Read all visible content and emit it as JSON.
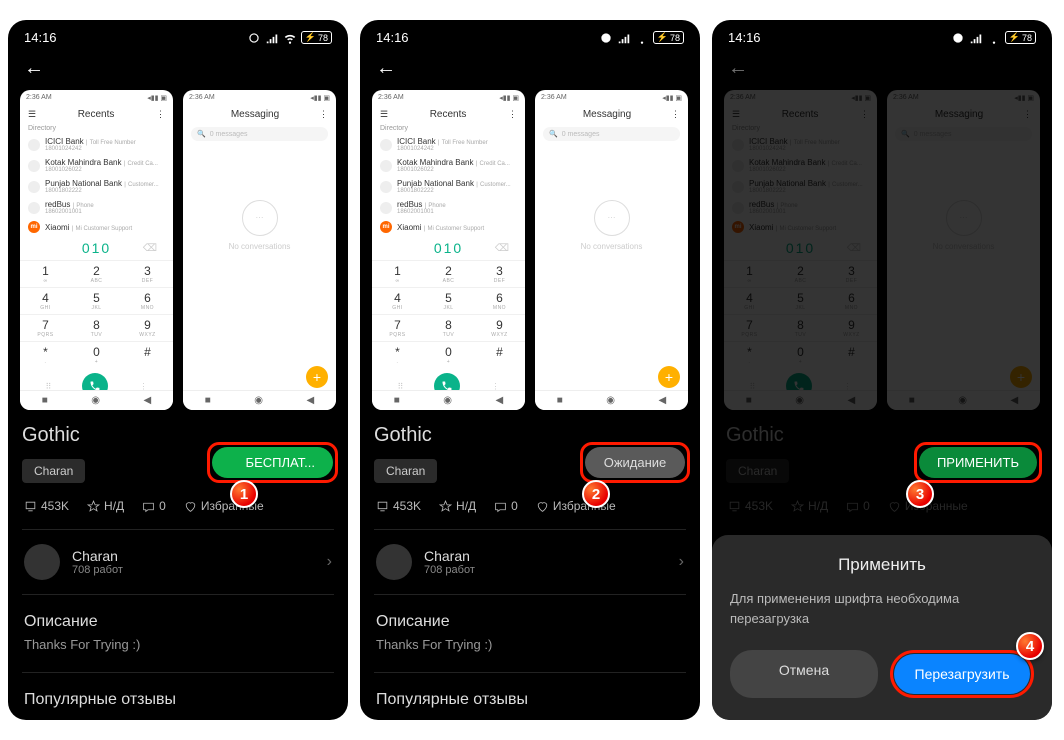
{
  "status": {
    "time": "14:16",
    "battery": "78"
  },
  "preview": {
    "recents_time": "2:36 AM",
    "recents_title": "Recents",
    "directory_label": "Directory",
    "contacts": [
      {
        "name": "ICICI Bank",
        "sub": "Toll Free Number",
        "num": "18001024242"
      },
      {
        "name": "Kotak Mahindra Bank",
        "sub": "Credit Ca...",
        "num": "18001026022"
      },
      {
        "name": "Punjab National Bank",
        "sub": "Customer...",
        "num": "18001802222"
      },
      {
        "name": "redBus",
        "sub": "Phone",
        "num": "18602001001"
      },
      {
        "name": "Xiaomi",
        "sub": "Mi Customer Support",
        "num": ""
      }
    ],
    "dialed": "010",
    "keys": [
      {
        "n": "1",
        "l": "∞"
      },
      {
        "n": "2",
        "l": "ABC"
      },
      {
        "n": "3",
        "l": "DEF"
      },
      {
        "n": "4",
        "l": "GHI"
      },
      {
        "n": "5",
        "l": "JKL"
      },
      {
        "n": "6",
        "l": "MNO"
      },
      {
        "n": "7",
        "l": "PQRS"
      },
      {
        "n": "8",
        "l": "TUV"
      },
      {
        "n": "9",
        "l": "WXYZ"
      },
      {
        "n": "*",
        "l": "."
      },
      {
        "n": "0",
        "l": "+"
      },
      {
        "n": "#",
        "l": ""
      }
    ],
    "messaging_title": "Messaging",
    "search_placeholder": "0 messages",
    "no_conversations": "No conversations"
  },
  "theme": {
    "title": "Gothic",
    "tag": "Charan",
    "downloads": "453K",
    "rating": "Н/Д",
    "comments": "0",
    "fav": "Избранные",
    "author_name": "Charan",
    "author_works": "708 работ",
    "desc_heading": "Описание",
    "desc_text": "Thanks For Trying :)",
    "reviews_heading": "Популярные отзывы"
  },
  "buttons": {
    "free": "БЕСПЛАТ...",
    "waiting": "Ожидание",
    "apply": "ПРИМЕНИТЬ"
  },
  "dialog": {
    "title": "Применить",
    "message": "Для применения шрифта необходима перезагрузка",
    "cancel": "Отмена",
    "confirm": "Перезагрузить"
  },
  "badges": {
    "b1": "1",
    "b2": "2",
    "b3": "3",
    "b4": "4"
  }
}
